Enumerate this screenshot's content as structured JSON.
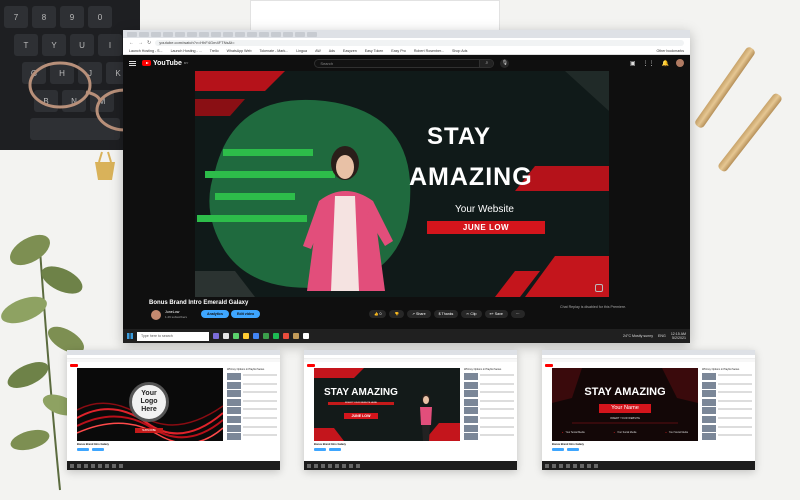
{
  "browser": {
    "url": "youtube.com/watch?v=HhF4Gm4FTNs&t=",
    "bookmarks": [
      "Launch Hosting - S...",
      "Launch Hosting - ...",
      "Trello",
      "WhatsApp Web",
      "Tokenate - Mark...",
      "Lingua",
      "AW",
      "Ads",
      "Easyzen",
      "Easy Token",
      "Easy Pro",
      "Robert Rosenber...",
      "Shop Ads"
    ],
    "other_bookmarks": "Other bookmarks"
  },
  "youtube": {
    "logo": "YouTube",
    "logo_region": "MY",
    "search_placeholder": "Search"
  },
  "video": {
    "line1": "STAY",
    "line2": "AMAZING",
    "website": "Your Website",
    "name": "JUNE LOW"
  },
  "below": {
    "title": "Bonus Brand Intro Emerald Galaxy",
    "channel": "JuneLow",
    "subscribers": "1.29 subscribers",
    "analytics": "Analytics",
    "edit_video": "Edit video",
    "like_count": "0",
    "share": "Share",
    "thanks": "Thanks",
    "clip": "Clip",
    "save": "Save",
    "chat_note": "Chat Replay is disabled for this Premiere."
  },
  "taskbar": {
    "search": "Type here to search",
    "weather": "24°C Mostly sunny",
    "lang": "ENG",
    "time": "12:15 AM",
    "date": "5/2/2021"
  },
  "mini1": {
    "logo_text": "Your Logo Here",
    "button": "SUBSCRIBE",
    "title": "Bonus Brand Intro Galaxy",
    "side_title": "Whimsy Options in Playlist Series"
  },
  "mini2": {
    "stay": "STAY AMAZING",
    "website": "INSERT YOUR WEBSITE HERE",
    "name": "JUNE LOW",
    "title": "Bonus Brand Intro Galaxy",
    "side_title": "Whimsy Options in Playlist Series"
  },
  "mini3": {
    "stay": "STAY AMAZING",
    "name": "Your Name",
    "website": "INSERT YOUR WEBSITE",
    "social1": "Your Social Media",
    "social2": "Your Social Media",
    "social3": "Your Social Media",
    "title": "Bonus Brand Intro Galaxy",
    "side_title": "Whimsy Options in Playlist Series"
  },
  "colors": {
    "accent_red": "#d4151c",
    "accent_green": "#2dbd4a",
    "yt_blue": "#3ea6ff"
  }
}
